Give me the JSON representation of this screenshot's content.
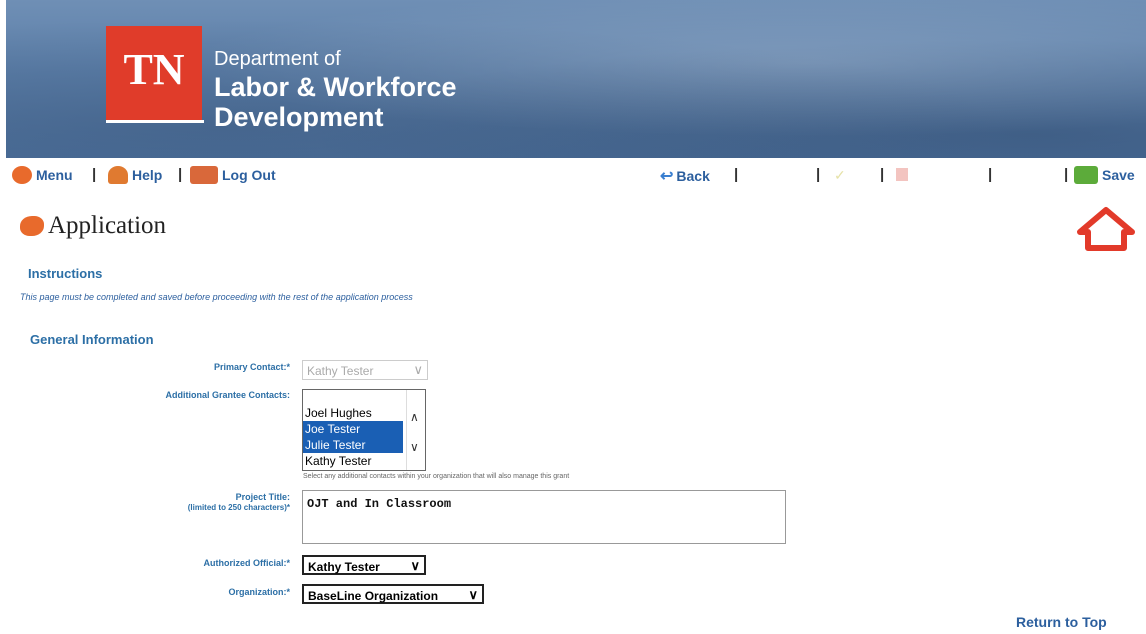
{
  "header": {
    "logo_text": "TN",
    "dept_line": "Department of",
    "title_line1": "Labor & Workforce",
    "title_line2": "Development"
  },
  "toolbar": {
    "menu": "Menu",
    "help": "Help",
    "logout": "Log Out",
    "back": "Back",
    "save": "Save",
    "separator": "|"
  },
  "page": {
    "title": "Application",
    "instructions_heading": "Instructions",
    "instructions_text": "This page must be completed and saved before proceeding with the rest of the application process",
    "general_heading": "General Information",
    "return_to_top": "Return to Top"
  },
  "form": {
    "primary_contact": {
      "label": "Primary Contact:*",
      "value": "Kathy Tester"
    },
    "additional_contacts": {
      "label": "Additional Grantee Contacts:",
      "options": [
        {
          "text": "Joel Hughes",
          "selected": false
        },
        {
          "text": "Joe Tester",
          "selected": true
        },
        {
          "text": "Julie Tester",
          "selected": true
        },
        {
          "text": "Kathy Tester",
          "selected": false
        }
      ],
      "hint": "Select any additional contacts within your organization that will also manage this grant"
    },
    "project_title": {
      "label": "Project Title:",
      "sublabel": "(limited to 250 characters)*",
      "value": "OJT and In Classroom"
    },
    "authorized_official": {
      "label": "Authorized Official:*",
      "value": "Kathy Tester"
    },
    "organization": {
      "label": "Organization:*",
      "value": "BaseLine Organization"
    }
  },
  "colors": {
    "brand_red": "#e03c2a",
    "link_blue": "#2c5f9e",
    "heading_blue": "#2c6fa6",
    "selection_blue": "#1a5fb4"
  }
}
